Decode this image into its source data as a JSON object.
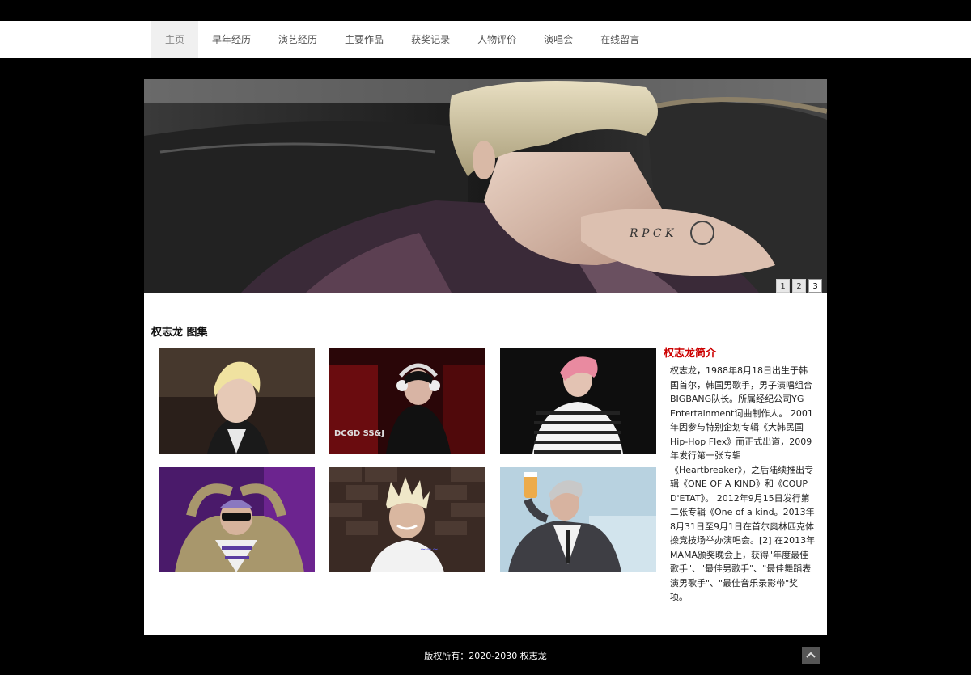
{
  "nav": {
    "items": [
      {
        "label": "主页"
      },
      {
        "label": "早年经历"
      },
      {
        "label": "演艺经历"
      },
      {
        "label": "主要作品"
      },
      {
        "label": "获奖记录"
      },
      {
        "label": "人物评价"
      },
      {
        "label": "演唱会"
      },
      {
        "label": "在线留言"
      }
    ],
    "active_index": 0
  },
  "banner": {
    "pager": [
      "1",
      "2",
      "3"
    ],
    "active_page": "3"
  },
  "gallery": {
    "title": "权志龙 图集",
    "photos": [
      {
        "name": "photo-1"
      },
      {
        "name": "photo-2",
        "caption": "DCGD SS&J"
      },
      {
        "name": "photo-3"
      },
      {
        "name": "photo-4"
      },
      {
        "name": "photo-5"
      },
      {
        "name": "photo-6"
      }
    ]
  },
  "intro": {
    "title": "权志龙简介",
    "text": "权志龙，1988年8月18日出生于韩国首尔，韩国男歌手，男子演唱组合BIGBANG队长。所属经纪公司YG Entertainment词曲制作人。 2001年因参与特别企划专辑《大韩民国Hip-Hop Flex》而正式出道，2009年发行第一张专辑《Heartbreaker》，之后陆续推出专辑《ONE OF A KIND》和《COUP D'ETAT》。 2012年9月15日发行第二张专辑《One of a kind。2013年8月31日至9月1日在首尔奥林匹克体操竞技场举办演唱会。[2] 在2013年MAMA颁奖晚会上，获得\"年度最佳歌手\"、\"最佳男歌手\"、\"最佳舞蹈表演男歌手\"、\"最佳音乐录影带\"奖项。"
  },
  "footer": {
    "copyright": "版权所有：2020-2030 权志龙"
  },
  "colors": {
    "page_bg": "#000000",
    "accent_red": "#cc0000",
    "nav_active_bg": "#f0f0f0"
  },
  "icons": {
    "back_to_top": "chevron-up-icon"
  }
}
